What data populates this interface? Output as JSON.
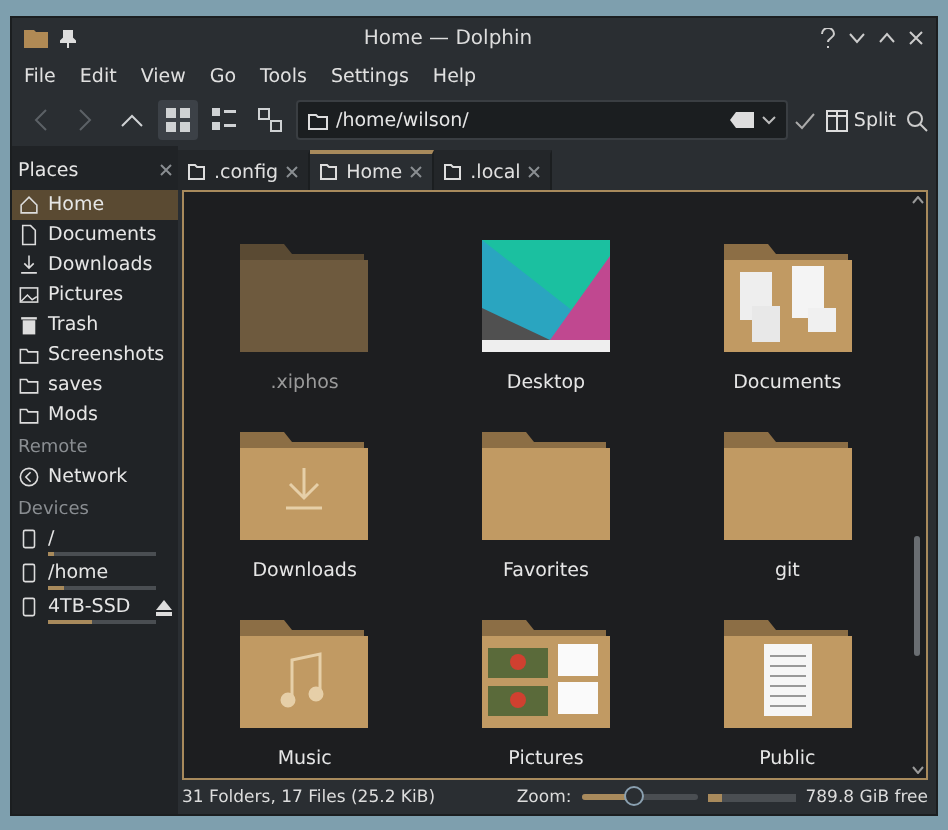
{
  "window": {
    "title": "Home — Dolphin"
  },
  "menu": [
    "File",
    "Edit",
    "View",
    "Go",
    "Tools",
    "Settings",
    "Help"
  ],
  "toolbar": {
    "path": "/home/wilson/",
    "split_label": "Split"
  },
  "places": {
    "title": "Places",
    "sections": [
      {
        "items": [
          {
            "label": "Home",
            "selected": true
          },
          {
            "label": "Documents",
            "selected": false
          },
          {
            "label": "Downloads",
            "selected": false
          },
          {
            "label": "Pictures",
            "selected": false
          },
          {
            "label": "Trash",
            "selected": false
          },
          {
            "label": "Screenshots",
            "selected": false
          },
          {
            "label": "saves",
            "selected": false
          },
          {
            "label": "Mods",
            "selected": false
          }
        ]
      },
      {
        "heading": "Remote",
        "items": [
          {
            "label": "Network",
            "selected": false
          }
        ]
      },
      {
        "heading": "Devices",
        "items": [
          {
            "label": "/",
            "selected": false,
            "level": 0.05,
            "ejectable": false
          },
          {
            "label": "/home",
            "selected": false,
            "level": 0.15,
            "ejectable": false
          },
          {
            "label": "4TB-SSD",
            "selected": false,
            "level": 0.4,
            "ejectable": true
          }
        ]
      }
    ]
  },
  "tabs": [
    {
      "label": ".config",
      "selected": false
    },
    {
      "label": "Home",
      "selected": true
    },
    {
      "label": ".local",
      "selected": false
    }
  ],
  "files": [
    {
      "name": ".xiphos",
      "kind": "folder",
      "hidden": true
    },
    {
      "name": "Desktop",
      "kind": "image",
      "hidden": false
    },
    {
      "name": "Documents",
      "kind": "documents",
      "hidden": false
    },
    {
      "name": "Downloads",
      "kind": "download",
      "hidden": false
    },
    {
      "name": "Favorites",
      "kind": "folder",
      "hidden": false
    },
    {
      "name": "git",
      "kind": "folder",
      "hidden": false
    },
    {
      "name": "Music",
      "kind": "music",
      "hidden": false
    },
    {
      "name": "Pictures",
      "kind": "pictures",
      "hidden": false
    },
    {
      "name": "Public",
      "kind": "public",
      "hidden": false
    }
  ],
  "status": {
    "summary": "31 Folders, 17 Files (25.2 KiB)",
    "zoom_label": "Zoom:",
    "zoom": {
      "level": 0.45
    },
    "space": {
      "level": 0.17
    },
    "free": "789.8 GiB free"
  }
}
